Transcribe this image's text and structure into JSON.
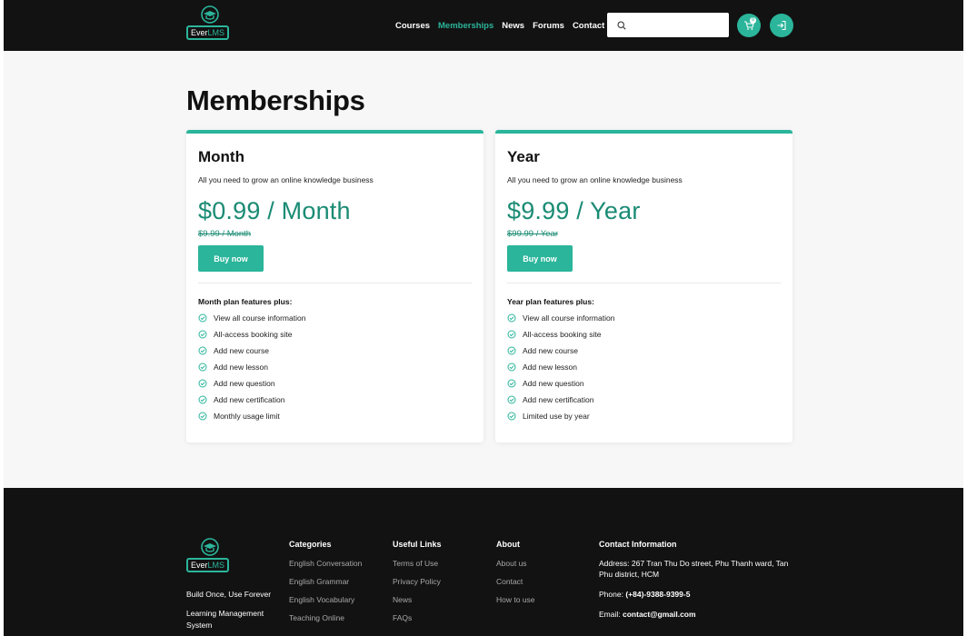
{
  "brand": {
    "logo_text_a": "Ever",
    "logo_text_b": "LMS"
  },
  "nav": {
    "items": [
      "Courses",
      "Memberships",
      "News",
      "Forums",
      "Contact Us"
    ],
    "active": "Memberships"
  },
  "search": {
    "placeholder": "",
    "value": ""
  },
  "cart": {
    "count": "0"
  },
  "page": {
    "title": "Memberships"
  },
  "plans": [
    {
      "name": "Month",
      "description": "All you need to grow an online knowledge business",
      "price": "$0.99 / Month",
      "old_price": "$9.99 / Month",
      "button": "Buy now",
      "features_title": "Month plan features plus:",
      "features": [
        "View all course information",
        "All-access booking site",
        "Add new course",
        "Add new lesson",
        "Add new question",
        "Add new certification",
        "Monthly usage limit"
      ]
    },
    {
      "name": "Year",
      "description": "All you need to grow an online knowledge business",
      "price": "$9.99 / Year",
      "old_price": "$99.99 / Year",
      "button": "Buy now",
      "features_title": "Year plan features plus:",
      "features": [
        "View all course information",
        "All-access booking site",
        "Add new course",
        "Add new lesson",
        "Add new question",
        "Add new certification",
        "Limited use by year"
      ]
    }
  ],
  "footer": {
    "tagline": "Build Once, Use Forever",
    "subtitle": "Learning Management System",
    "categories": {
      "title": "Categories",
      "links": [
        "English Conversation",
        "English Grammar",
        "English Vocabulary",
        "Teaching Online"
      ]
    },
    "useful_links": {
      "title": "Useful Links",
      "links": [
        "Terms of Use",
        "Privacy Policy",
        "News",
        "FAQs"
      ]
    },
    "about": {
      "title": "About",
      "links": [
        "About us",
        "Contact",
        "How to use"
      ]
    },
    "contact": {
      "title": "Contact Information",
      "address_label": "Address:",
      "address": "267 Tran Thu Do street, Phu Thanh ward, Tan Phu district, HCM",
      "phone_label": "Phone:",
      "phone": "(+84)-9388-9399-5",
      "email_label": "Email:",
      "email": "contact@gmail.com"
    }
  },
  "colors": {
    "accent": "#2bb59b",
    "price": "#1a8b74",
    "header_bg": "#121212",
    "main_bg": "#f7f7f7"
  },
  "icons": {
    "search": "search-icon",
    "cart": "cart-icon",
    "login": "login-icon",
    "feature": "check-circle-icon",
    "logo": "graduation-cap-icon"
  }
}
